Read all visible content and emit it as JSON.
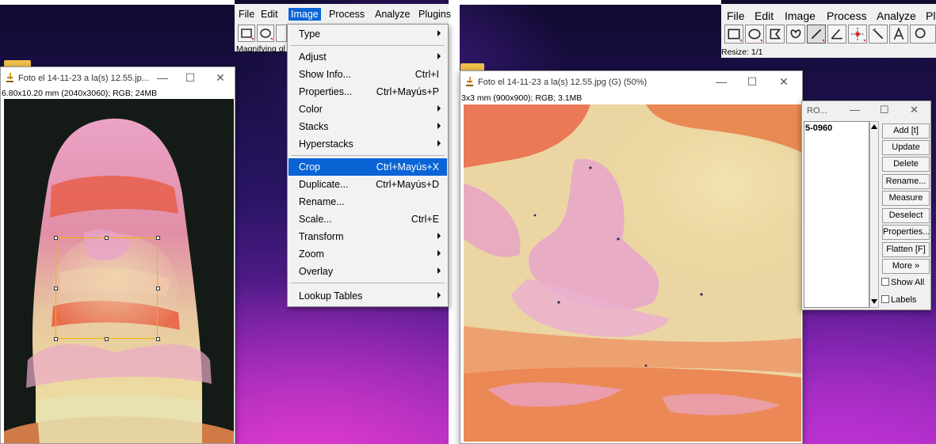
{
  "left_window": {
    "title": "Foto el 14-11-23 a la(s) 12.55.jp...",
    "info": "6.80x10.20 mm (2040x3060); RGB; 24MB"
  },
  "imagej_toolbar_1": {
    "menus": [
      "File",
      "Edit",
      "Image",
      "Process",
      "Analyze",
      "Plugins"
    ],
    "active_menu": "Image",
    "status": "Magnifying gl"
  },
  "image_menu": {
    "items": [
      {
        "label": "Type",
        "shortcut": "",
        "submenu": true
      },
      {
        "label": "Adjust",
        "shortcut": "",
        "submenu": true
      },
      {
        "label": "Show Info...",
        "shortcut": "Ctrl+I",
        "submenu": false
      },
      {
        "label": "Properties...",
        "shortcut": "Ctrl+Mayús+P",
        "submenu": false
      },
      {
        "label": "Color",
        "shortcut": "",
        "submenu": true
      },
      {
        "label": "Stacks",
        "shortcut": "",
        "submenu": true
      },
      {
        "label": "Hyperstacks",
        "shortcut": "",
        "submenu": true
      },
      {
        "label": "Crop",
        "shortcut": "Ctrl+Mayús+X",
        "submenu": false,
        "highlighted": true
      },
      {
        "label": "Duplicate...",
        "shortcut": "Ctrl+Mayús+D",
        "submenu": false
      },
      {
        "label": "Rename...",
        "shortcut": "",
        "submenu": false
      },
      {
        "label": "Scale...",
        "shortcut": "Ctrl+E",
        "submenu": false
      },
      {
        "label": "Transform",
        "shortcut": "",
        "submenu": true
      },
      {
        "label": "Zoom",
        "shortcut": "",
        "submenu": true
      },
      {
        "label": "Overlay",
        "shortcut": "",
        "submenu": true
      },
      {
        "label": "Lookup Tables",
        "shortcut": "",
        "submenu": true
      }
    ]
  },
  "right_window": {
    "title": "Foto el 14-11-23 a la(s) 12.55.jpg (G) (50%)",
    "info": "3x3 mm (900x900); RGB; 3.1MB"
  },
  "imagej_toolbar_2": {
    "menus": [
      "File",
      "Edit",
      "Image",
      "Process",
      "Analyze",
      "Pl"
    ],
    "status": "Resize: 1/1"
  },
  "roi_manager": {
    "title": "RO...",
    "list_items": [
      "5-0960"
    ],
    "buttons": [
      "Add [t]",
      "Update",
      "Delete",
      "Rename...",
      "Measure",
      "Deselect",
      "Properties...",
      "Flatten [F]",
      "More »"
    ],
    "checkboxes": [
      "Show All",
      "Labels"
    ]
  },
  "colors": {
    "menu_highlight": "#0a64d6",
    "roi_selection": "#f0b400",
    "tooth_pink": "#e6a0c2",
    "tooth_red": "#e8583d",
    "tooth_yellow": "#e9dd9e"
  }
}
